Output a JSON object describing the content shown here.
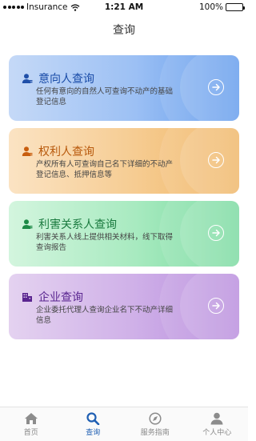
{
  "status_bar": {
    "carrier": "Insurance",
    "time": "1:21 AM",
    "battery": "100%",
    "battery_level": 1.0
  },
  "header": {
    "title": "查询"
  },
  "cards": [
    {
      "title": "意向人查询",
      "description": "任何有意向的自然人可查询不动产的基础登记信息",
      "icon": "person-icon",
      "accent": "#1a4ca8"
    },
    {
      "title": "权利人查询",
      "description": "产权所有人可查询自己名下详细的不动产登记信息、抵押信息等",
      "icon": "person-icon",
      "accent": "#b8590c"
    },
    {
      "title": "利害关系人查询",
      "description": "利害关系人线上提供相关材料，线下取得查询报告",
      "icon": "person-icon",
      "accent": "#1a7a3f"
    },
    {
      "title": "企业查询",
      "description": "企业委托代理人查询企业名下不动产详细信息",
      "icon": "building-icon",
      "accent": "#5a2590"
    }
  ],
  "tabbar": {
    "items": [
      {
        "label": "首页",
        "icon": "home-icon"
      },
      {
        "label": "查询",
        "icon": "search-icon",
        "active": true
      },
      {
        "label": "服务指南",
        "icon": "compass-icon"
      },
      {
        "label": "个人中心",
        "icon": "user-icon"
      }
    ]
  },
  "colors": {
    "active_tab": "#1f5fb3",
    "inactive_tab": "#888888"
  }
}
